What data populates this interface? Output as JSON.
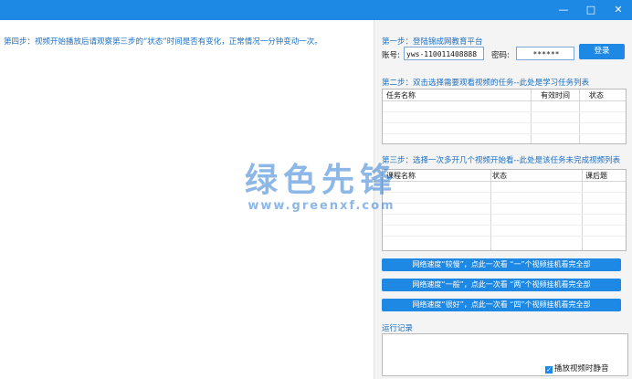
{
  "window": {
    "minimize": "—",
    "maximize": "□",
    "close": "✕"
  },
  "left": {
    "step4": "第四步：视频开始播放后请观察第三步的“状态”时间是否有变化，正常情况一分钟变动一次。"
  },
  "step1": {
    "title": "第一步：登陆锦成网教育平台",
    "account_label": "账号:",
    "account_value": "yws-110011408888",
    "password_label": "密码:",
    "password_value": "******",
    "login_button": "登录"
  },
  "step2": {
    "title": "第二步：双击选择需要观看视频的任务--此处是学习任务列表",
    "columns": [
      "任务名称",
      "有效时间",
      "状态"
    ]
  },
  "step3": {
    "title": "第三步：选择一次多开几个视频开始看--此处是该任务未完成视频列表",
    "columns": [
      "课程名称",
      "状态",
      "课后题"
    ]
  },
  "actions": {
    "slow": "网络速度“较慢”，点此一次看 “一”个视频挂机看完全部",
    "normal": "网络速度“一般”，点此一次看 “两”个视频挂机看完全部",
    "fast": "网络速度“很好”，点此一次看 “四”个视频挂机看完全部"
  },
  "log": {
    "title": "运行记录",
    "mute_label": "播放视频时静音"
  },
  "watermark": {
    "big": "绿色先锋",
    "small": "www.greenxf.com"
  },
  "colors": {
    "accent": "#1e88e5",
    "section_title": "#1a6fc4"
  }
}
